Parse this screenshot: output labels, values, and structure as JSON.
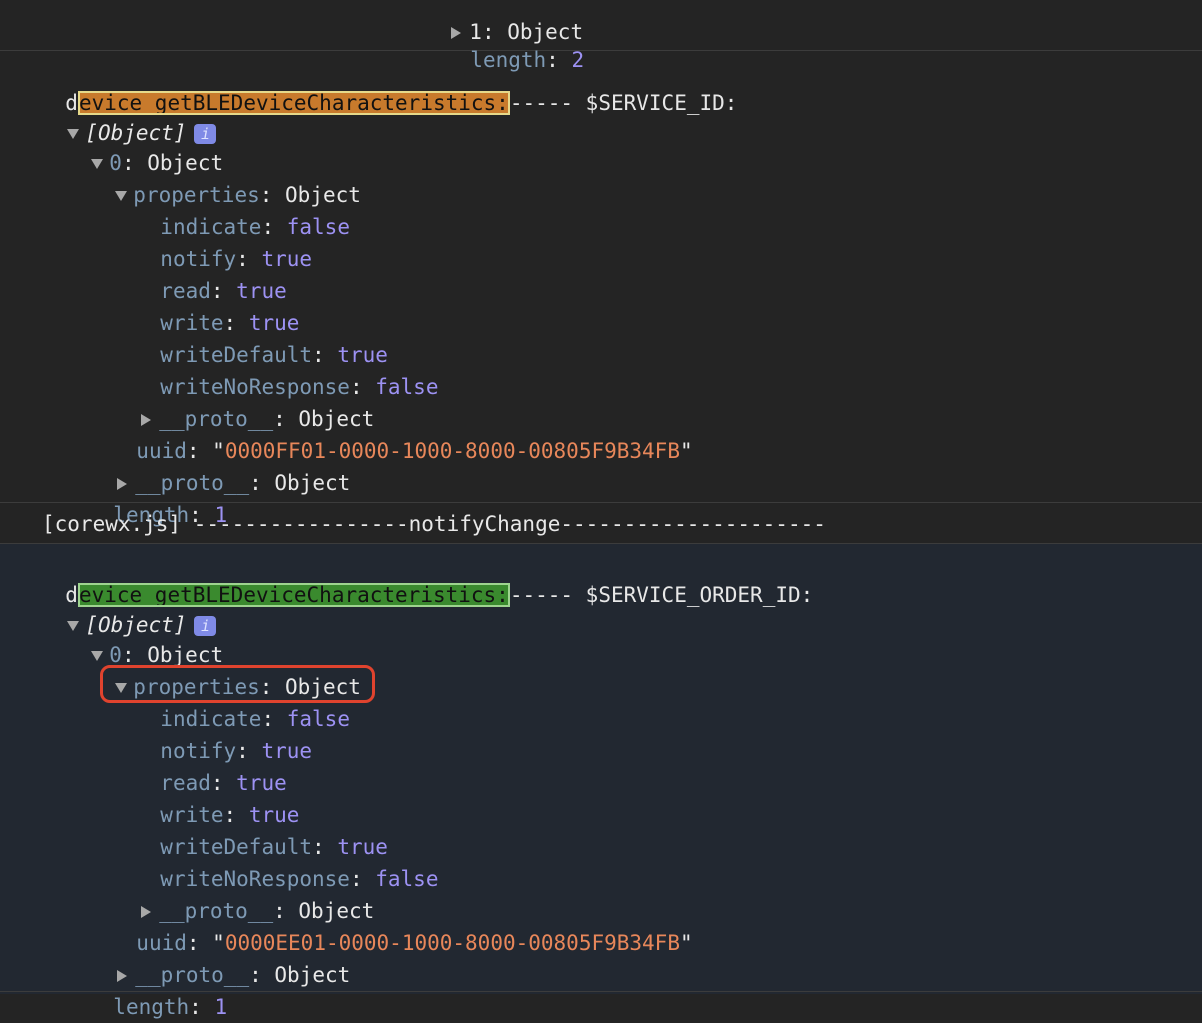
{
  "prev": {
    "object_row_label": "1: Object",
    "length_key": "length",
    "length_value": "2"
  },
  "log1": {
    "prefix_char": "d",
    "highlight_text": "evice getBLEDeviceCharacteristics:",
    "suffix": "----- $SERVICE_ID:",
    "root_label": "[Object]",
    "info_badge": "i",
    "item_label": "0",
    "object_word": "Object",
    "properties": {
      "key": "properties",
      "rows": [
        {
          "key": "indicate",
          "value": "false"
        },
        {
          "key": "notify",
          "value": "true"
        },
        {
          "key": "read",
          "value": "true"
        },
        {
          "key": "write",
          "value": "true"
        },
        {
          "key": "writeDefault",
          "value": "true"
        },
        {
          "key": "writeNoResponse",
          "value": "false"
        }
      ]
    },
    "proto_key": "__proto__",
    "uuid_key": "uuid",
    "uuid_value": "0000FF01-0000-1000-8000-00805F9B34FB",
    "length_key": "length",
    "length_value": "1"
  },
  "notify_line": "[corewx.js] -----------------notifyChange---------------------",
  "log2": {
    "prefix_char": "d",
    "highlight_text": "evice getBLEDeviceCharacteristics:",
    "suffix": "----- $SERVICE_ORDER_ID:",
    "root_label": "[Object]",
    "info_badge": "i",
    "item_label": "0",
    "object_word": "Object",
    "properties": {
      "key": "properties",
      "rows": [
        {
          "key": "indicate",
          "value": "false"
        },
        {
          "key": "notify",
          "value": "true"
        },
        {
          "key": "read",
          "value": "true"
        },
        {
          "key": "write",
          "value": "true"
        },
        {
          "key": "writeDefault",
          "value": "true"
        },
        {
          "key": "writeNoResponse",
          "value": "false"
        }
      ]
    },
    "proto_key": "__proto__",
    "uuid_key": "uuid",
    "uuid_value": "0000EE01-0000-1000-8000-00805F9B34FB",
    "length_key": "length",
    "length_value": "1"
  },
  "colors": {
    "background": "#242424",
    "alt_background": "#222831",
    "key": "#7e9ab5",
    "boolean": "#9d92f3",
    "string": "#e8875a",
    "highlight_orange": "#c87a2c",
    "highlight_green": "#3a8a2e",
    "annotation_red": "#e0432e"
  }
}
